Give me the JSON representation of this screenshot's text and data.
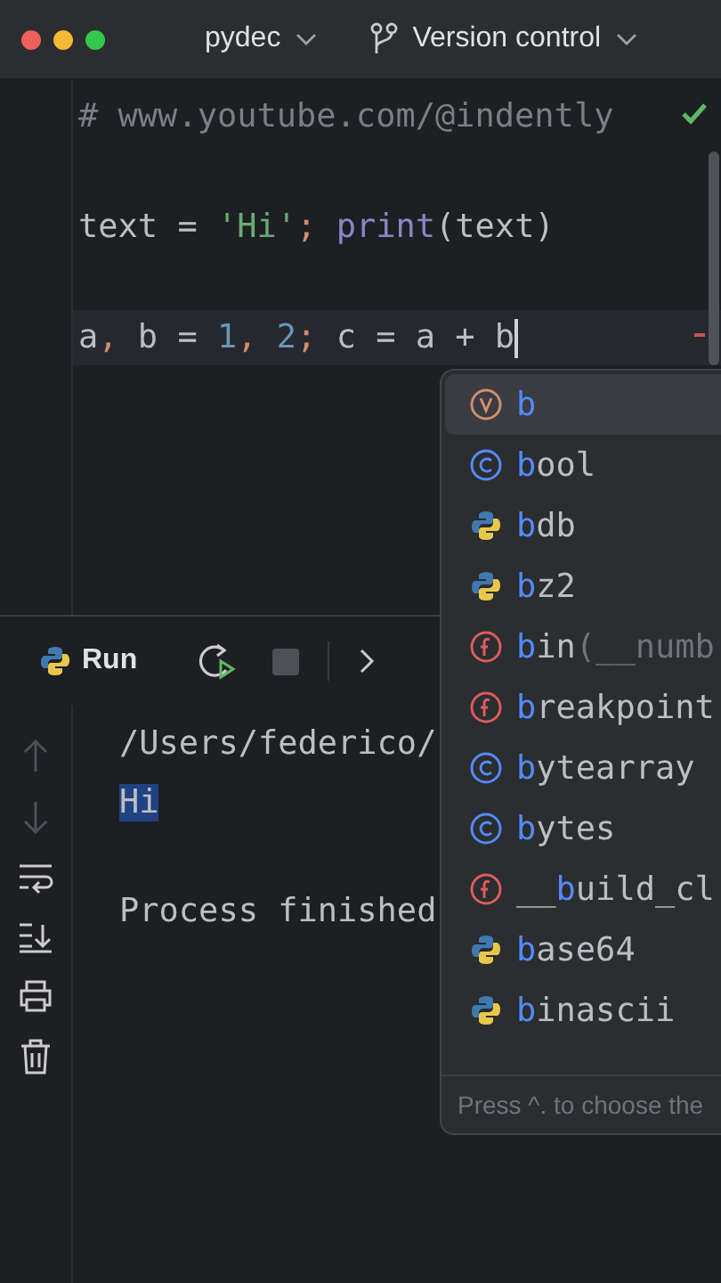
{
  "title_bar": {
    "project": "pydec",
    "vcs": "Version control"
  },
  "editor": {
    "lines": [
      {
        "tokens": [
          {
            "kind": "comment",
            "text": "# www.youtube.com/@indently"
          }
        ],
        "current": false
      },
      {
        "tokens": [
          {
            "kind": "plain",
            "text": "text = "
          },
          {
            "kind": "string",
            "text": "'Hi'"
          },
          {
            "kind": "punct",
            "text": "; "
          },
          {
            "kind": "builtin",
            "text": "print"
          },
          {
            "kind": "plain",
            "text": "(text)"
          }
        ],
        "current": false
      },
      {
        "tokens": [
          {
            "kind": "plain",
            "text": "a"
          },
          {
            "kind": "punct",
            "text": ", "
          },
          {
            "kind": "plain",
            "text": "b = "
          },
          {
            "kind": "number",
            "text": "1"
          },
          {
            "kind": "punct",
            "text": ", "
          },
          {
            "kind": "number",
            "text": "2"
          },
          {
            "kind": "punct",
            "text": "; "
          },
          {
            "kind": "plain",
            "text": "c = a + b"
          }
        ],
        "current": true
      }
    ]
  },
  "completion": {
    "items": [
      {
        "kind": "variable",
        "match": "b",
        "selected": true
      },
      {
        "kind": "class",
        "match": "b",
        "rest": "ool",
        "selected": false
      },
      {
        "kind": "module",
        "match": "b",
        "rest": "db",
        "selected": false
      },
      {
        "kind": "module",
        "match": "b",
        "rest": "z2",
        "selected": false
      },
      {
        "kind": "function",
        "match": "b",
        "rest": "in",
        "hint": "(__numb",
        "selected": false
      },
      {
        "kind": "function",
        "match": "b",
        "rest": "reakpoint",
        "selected": false
      },
      {
        "kind": "class",
        "match": "b",
        "rest": "ytearray",
        "selected": false
      },
      {
        "kind": "class",
        "match": "b",
        "rest": "ytes",
        "selected": false
      },
      {
        "kind": "function",
        "before": "__",
        "match": "b",
        "rest": "uild_cl",
        "selected": false
      },
      {
        "kind": "module",
        "match": "b",
        "rest": "ase64",
        "selected": false
      },
      {
        "kind": "module",
        "match": "b",
        "rest": "inascii",
        "selected": false
      }
    ],
    "footer": "Press ^. to choose the"
  },
  "run_panel": {
    "title": "Run"
  },
  "console": {
    "lines": [
      {
        "kind": "output",
        "text": "/Users/federico/",
        "selected": false
      },
      {
        "kind": "output",
        "text": "Hi",
        "selected": true
      },
      {
        "kind": "status",
        "text": "Process finished",
        "selected": false
      }
    ]
  }
}
